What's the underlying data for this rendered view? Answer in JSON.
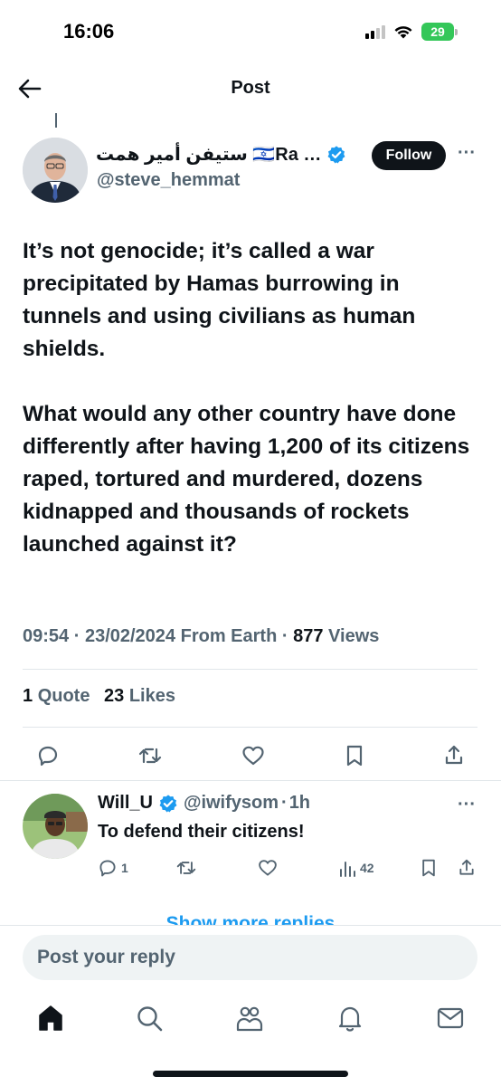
{
  "status_bar": {
    "time": "16:06",
    "battery": "29"
  },
  "header": {
    "title": "Post",
    "back_icon": "arrow-left-icon"
  },
  "post": {
    "author_name": "ستيفن أمير همت 🇮🇱Ra …",
    "handle": "@steve_hemmat",
    "follow_label": "Follow",
    "more_label": "···",
    "paragraphs": [
      "It’s not genocide; it’s called a war precipitated by Hamas burrowing in tunnels and using civilians as human shields.",
      "What would any other country have done differently after having 1,200 of its citizens raped, tortured and murdered, dozens kidnapped and thousands of rockets launched against it?"
    ],
    "time": "09:54",
    "sep": "·",
    "date": "23/02/2024",
    "source": "From Earth",
    "views_count": "877",
    "views_label": "Views",
    "quotes_count": "1",
    "quotes_label": "Quote",
    "likes_count": "23",
    "likes_label": "Likes"
  },
  "reply": {
    "name": "Will_U",
    "handle": "@iwifysom",
    "sep": "·",
    "time": "1h",
    "text": "To defend their citizens!",
    "reply_count": "1",
    "views_count": "42",
    "more_label": "···"
  },
  "show_more_replies": "Show more replies",
  "reply_box": {
    "placeholder": "Post your reply"
  },
  "colors": {
    "text": "#0f1419",
    "secondary": "#536471",
    "accent": "#1d9bf0",
    "battery": "#34c759"
  }
}
